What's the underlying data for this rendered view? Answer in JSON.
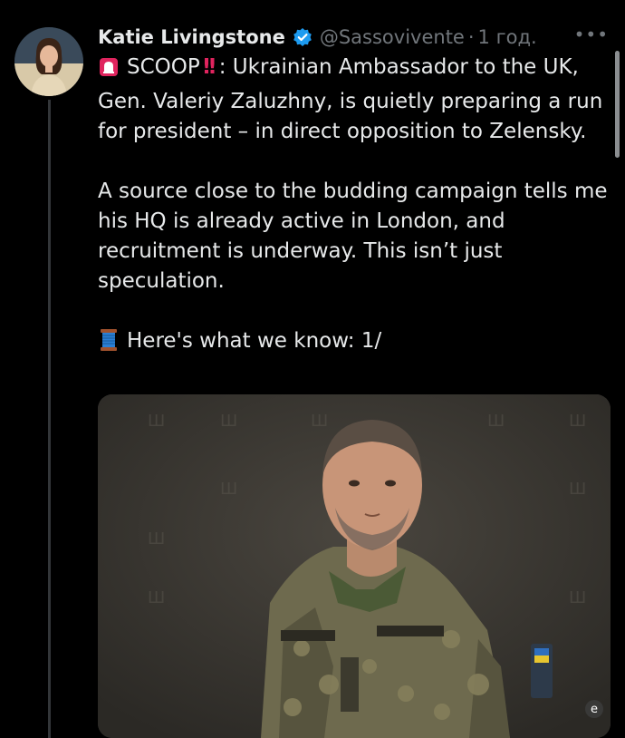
{
  "tweet": {
    "author": {
      "display_name": "Katie Livingstone",
      "handle": "@Sassovivente",
      "verified": true,
      "avatar_icon": "user-avatar"
    },
    "timestamp": "1 год.",
    "separator": "·",
    "more_label": "•••",
    "paragraphs": [
      {
        "icon": "siren-icon",
        "scoop_label": "SCOOP",
        "alert_icon": "double-exclamation-icon",
        "text": ": Ukrainian Ambassador to the UK, Gen. Valeriy Zaluzhny, is quietly preparing a run for president – in direct opposition to Zelensky."
      },
      {
        "text": "A source close to the budding campaign tells me his HQ is already active in London, and recruitment is underway. This isn’t just speculation."
      },
      {
        "icon": "thread-spool-icon",
        "text": "Here's what we know: 1/"
      }
    ],
    "media": {
      "type": "photo",
      "description_icon": "portrait-photo",
      "watermark": "e"
    },
    "colors": {
      "background": "#000000",
      "text": "#e7e9ea",
      "secondary": "#71767b",
      "verified": "#1d9bf0",
      "alert": "#e0245e"
    }
  }
}
